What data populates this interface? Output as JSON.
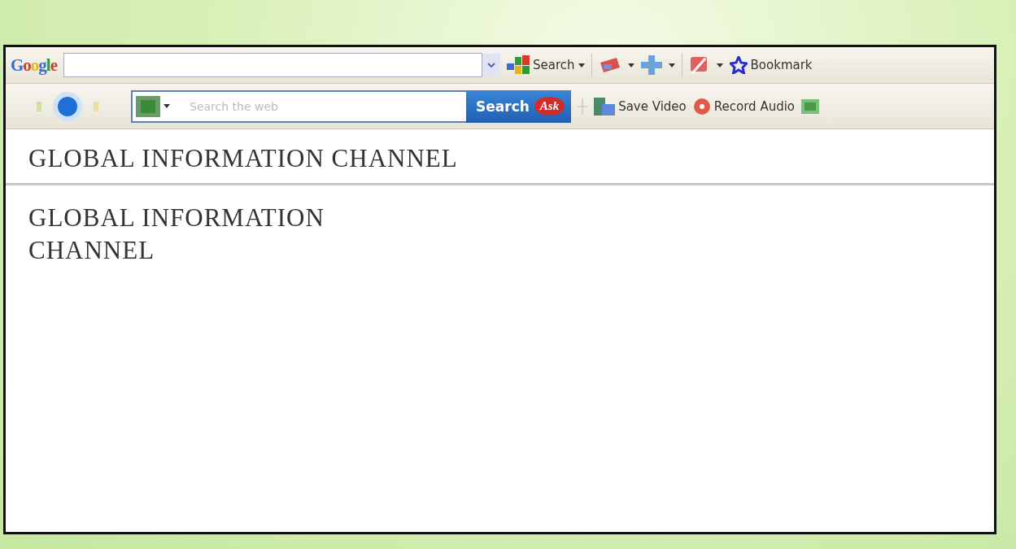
{
  "google_toolbar": {
    "logo": "Google",
    "search_button": "Search",
    "bookmarks": "Bookmark"
  },
  "ask_toolbar": {
    "placeholder": "Search the web",
    "search_button": "Search",
    "ask_logo": "Ask",
    "buttons": [
      {
        "kind": "video",
        "label": "Save Video"
      },
      {
        "kind": "audio",
        "label": "Record Audio"
      }
    ]
  },
  "page": {
    "heading": "GLOBAL INFORMATION CHANNEL",
    "paragraph": "GLOBAL INFORMATION CHANNEL"
  }
}
